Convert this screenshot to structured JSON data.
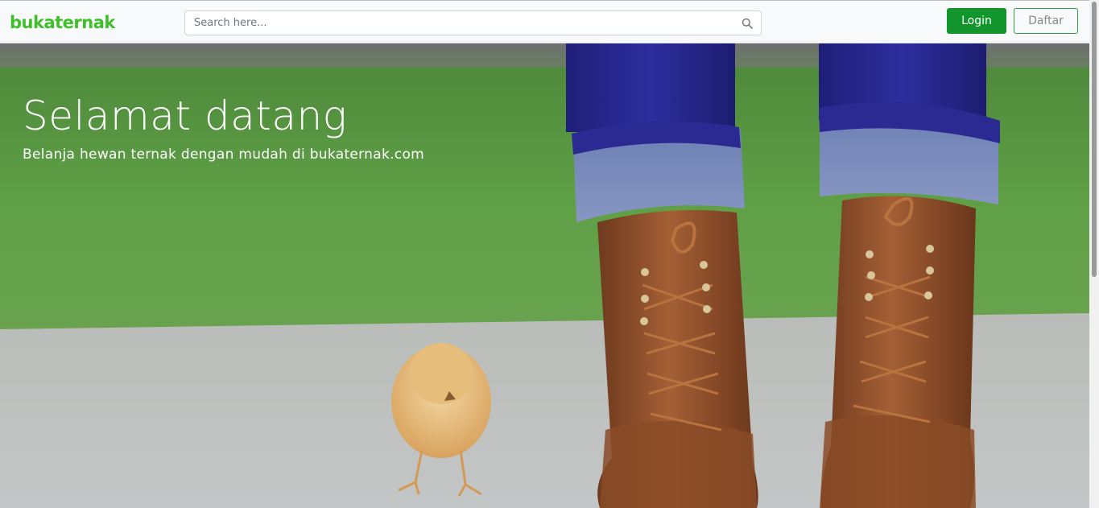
{
  "brand": {
    "name": "bukaternak",
    "color": "#3fbf2a"
  },
  "search": {
    "placeholder": "Search here...",
    "value": ""
  },
  "auth": {
    "login_label": "Login",
    "register_label": "Daftar",
    "accent": "#12962b"
  },
  "hero": {
    "title": "Selamat datang",
    "subtitle": "Belanja hewan ternak dengan mudah di bukaternak.com",
    "image_subject": "chick-and-boots"
  },
  "icons": {
    "search": "search-icon"
  }
}
